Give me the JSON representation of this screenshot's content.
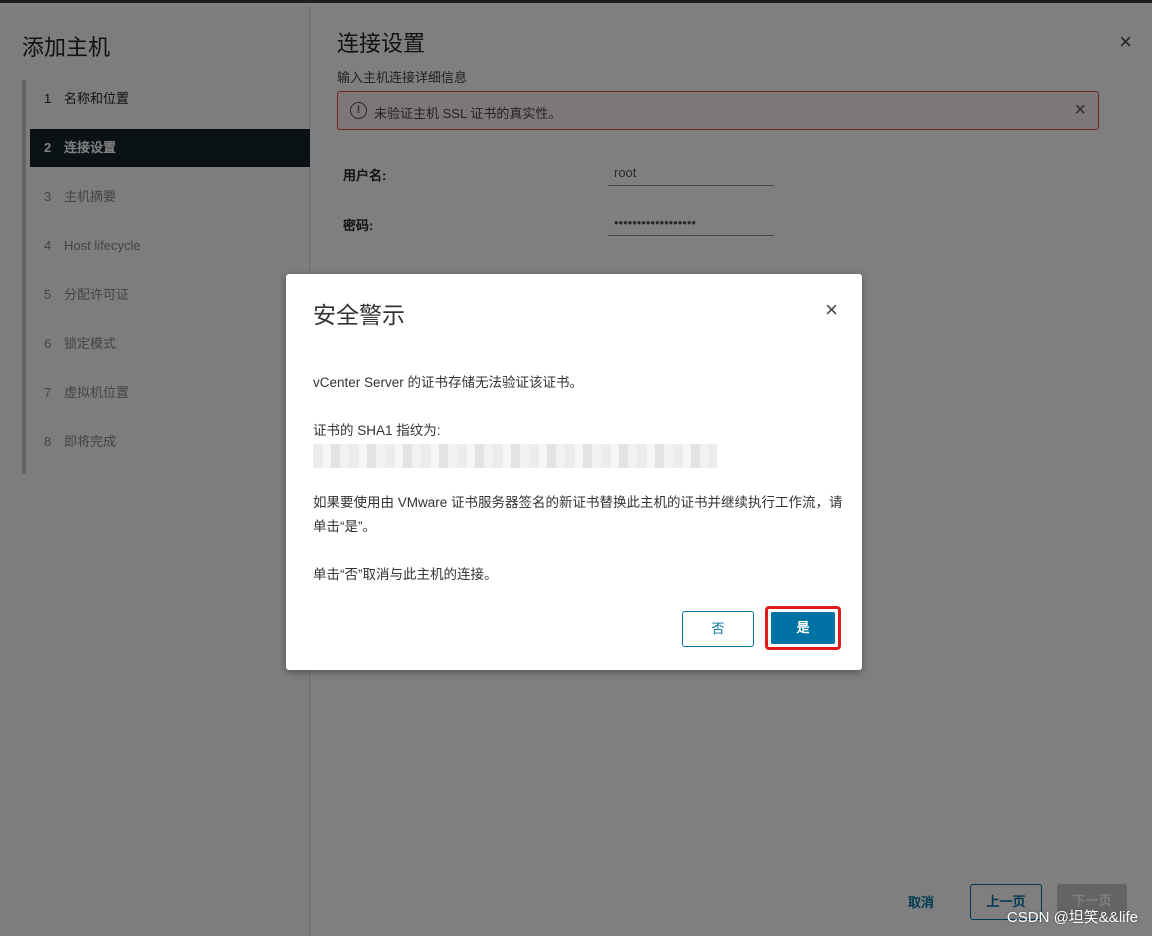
{
  "wizard": {
    "title": "添加主机",
    "steps": [
      {
        "num": "1",
        "label": "名称和位置"
      },
      {
        "num": "2",
        "label": "连接设置"
      },
      {
        "num": "3",
        "label": "主机摘要"
      },
      {
        "num": "4",
        "label": "Host lifecycle"
      },
      {
        "num": "5",
        "label": "分配许可证"
      },
      {
        "num": "6",
        "label": "锁定模式"
      },
      {
        "num": "7",
        "label": "虚拟机位置"
      },
      {
        "num": "8",
        "label": "即将完成"
      }
    ]
  },
  "main": {
    "title": "连接设置",
    "subtitle": "输入主机连接详细信息",
    "close_icon": "×",
    "alert": {
      "icon": "!",
      "text": "未验证主机 SSL 证书的真实性。",
      "close_icon": "×"
    },
    "username_label": "用户名:",
    "username_value": "root",
    "password_label": "密码:",
    "password_value": "••••••••••••••••••"
  },
  "footer": {
    "cancel": "取消",
    "back": "上一页",
    "next": "下一页"
  },
  "modal": {
    "title": "安全警示",
    "close_icon": "×",
    "line1": "vCenter Server 的证书存储无法验证该证书。",
    "line2": "证书的 SHA1 指纹为:",
    "line3": "如果要使用由 VMware 证书服务器签名的新证书替换此主机的证书并继续执行工作流，请单击“是”。",
    "line4": "单击“否”取消与此主机的连接。",
    "no_button": "否",
    "yes_button": "是"
  },
  "watermark": "CSDN @坦笑&&life"
}
